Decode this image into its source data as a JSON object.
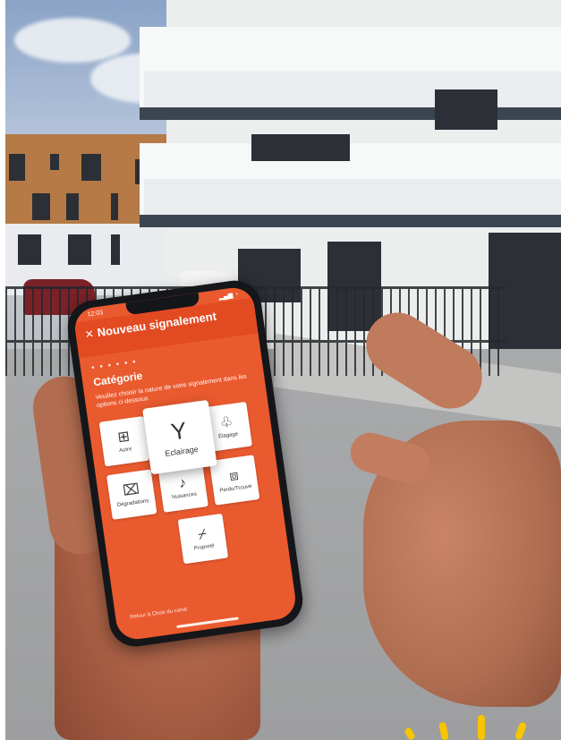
{
  "phone": {
    "status": {
      "time": "12:03",
      "icons": "▂▄▆ ◔"
    },
    "header": {
      "title": "Nouveau signalement"
    },
    "step_dots": "● ● ● ● ● ●",
    "section_title": "Catégorie",
    "description": "Veuillez choisir la nature de votre signalement dans les options ci-dessous",
    "categories": [
      {
        "label": "Autre",
        "icon": "grid-icon"
      },
      {
        "label": "Éclairage",
        "icon": "street-light-icon"
      },
      {
        "label": "Élagage",
        "icon": "tree-icon"
      },
      {
        "label": "Dégradations",
        "icon": "broken-icon"
      },
      {
        "label": "Nuisances",
        "icon": "noise-icon"
      },
      {
        "label": "Perdu/Trouvé",
        "icon": "box-icon"
      },
      {
        "label": "Propreté",
        "icon": "broom-icon"
      }
    ],
    "selected_label": "Eclairage",
    "back_link": "Retour à Choix du canal"
  },
  "colors": {
    "accent": "#ea5a2f",
    "header": "#e24a22",
    "sun": "#f7c500"
  }
}
